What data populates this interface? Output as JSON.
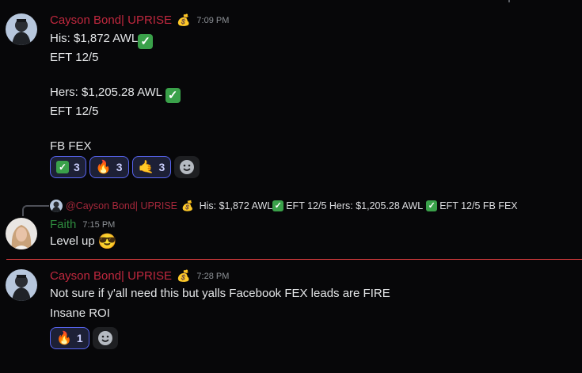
{
  "messages": [
    {
      "author": "Cayson Bond| UPRISE",
      "badge": "💰",
      "time": "7:09 PM",
      "lines": {
        "his_text": "His: $1,872 AWL",
        "his_eft": "EFT 12/5",
        "hers_text": "Hers: $1,205.28 AWL",
        "hers_eft": "EFT 12/5",
        "product": "FB FEX"
      },
      "reactions": [
        {
          "emoji": "✅",
          "count": "3"
        },
        {
          "emoji": "🔥",
          "count": "3"
        },
        {
          "emoji": "🤙",
          "count": "3"
        }
      ]
    },
    {
      "reply": {
        "author": "@Cayson Bond| UPRISE",
        "badge": "💰",
        "text_his": "His: $1,872 AWL",
        "text_hers": "EFT 12/5  Hers: $1,205.28 AWL",
        "text_end": "EFT 12/5  FB FEX"
      },
      "author": "Faith",
      "time": "7:15 PM",
      "text": "Level up",
      "emoji": "😎"
    },
    {
      "author": "Cayson Bond| UPRISE",
      "badge": "💰",
      "time": "7:28 PM",
      "line1": "Not sure if y'all need this but yalls Facebook FEX leads are FIRE",
      "line2": "Insane ROI",
      "reactions": [
        {
          "emoji": "🔥",
          "count": "1"
        }
      ]
    }
  ],
  "icons": {
    "checkmark": "✓",
    "add_reaction": "smiley-plus-icon"
  },
  "colors": {
    "accent": "#5865f2",
    "new_divider": "#d83c3e",
    "author_red": "#c0283e",
    "author_green": "#2e8b3e"
  }
}
